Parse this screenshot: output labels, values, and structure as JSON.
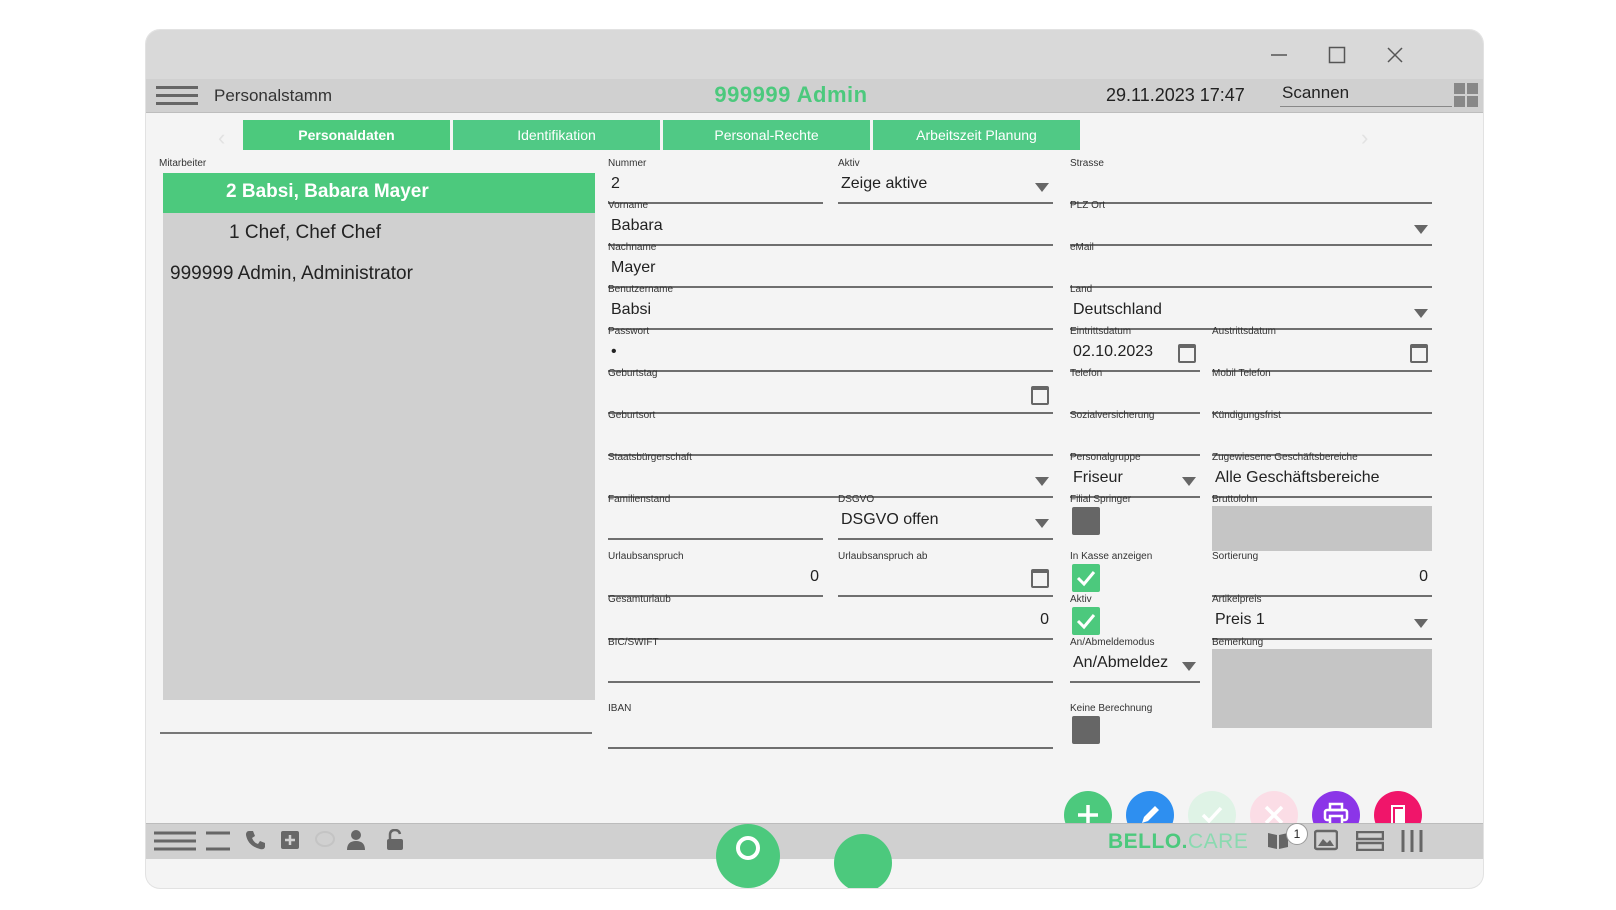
{
  "window": {
    "controls": {
      "minimize": "minimize-icon",
      "maximize": "maximize-icon",
      "close": "close-icon"
    }
  },
  "header": {
    "title": "Personalstamm",
    "user": "999999 Admin",
    "datetime": "29.11.2023 17:47",
    "scan_placeholder": "Scannen"
  },
  "tabs": [
    "Personaldaten",
    "Identifikation",
    "Personal-Rechte",
    "Arbeitszeit Planung"
  ],
  "employees": {
    "label": "Mitarbeiter",
    "items": [
      "2 Babsi, Babara Mayer",
      "1 Chef, Chef Chef",
      "999999 Admin, Administrator"
    ],
    "selected_index": 0
  },
  "form": {
    "nummer": {
      "label": "Nummer",
      "value": "2"
    },
    "aktiv_filter": {
      "label": "Aktiv",
      "value": "Zeige aktive"
    },
    "strasse": {
      "label": "Strasse",
      "value": ""
    },
    "vorname": {
      "label": "Vorname",
      "value": "Babara"
    },
    "plz_ort": {
      "label": "PLZ Ort",
      "value": ""
    },
    "nachname": {
      "label": "Nachname",
      "value": "Mayer"
    },
    "email": {
      "label": "eMail",
      "value": ""
    },
    "benutzername": {
      "label": "Benutzername",
      "value": "Babsi"
    },
    "land": {
      "label": "Land",
      "value": "Deutschland"
    },
    "passwort": {
      "label": "Passwort",
      "value": "•"
    },
    "eintrittsdatum": {
      "label": "Eintrittsdatum",
      "value": "02.10.2023"
    },
    "austrittsdatum": {
      "label": "Austrittsdatum",
      "value": ""
    },
    "geburtstag": {
      "label": "Geburtstag",
      "value": ""
    },
    "telefon": {
      "label": "Telefon",
      "value": ""
    },
    "mobil": {
      "label": "Mobil Telefon",
      "value": ""
    },
    "geburtsort": {
      "label": "Geburtsort",
      "value": ""
    },
    "sozialversicherung": {
      "label": "Sozialversicherung",
      "value": ""
    },
    "kuendigungsfrist": {
      "label": "Kündigungsfrist",
      "value": ""
    },
    "staatsbuergerschaft": {
      "label": "Staatsbürgerschaft",
      "value": ""
    },
    "personalgruppe": {
      "label": "Personalgruppe",
      "value": "Friseur"
    },
    "geschaeftsbereiche": {
      "label": "Zugewiesene Geschäftsbereiche",
      "value": "Alle Geschäftsbereiche"
    },
    "familienstand": {
      "label": "Familienstand",
      "value": ""
    },
    "dsgvo": {
      "label": "DSGVO",
      "value": "DSGVO offen"
    },
    "filial_springer": {
      "label": "Filial Springer",
      "checked": false
    },
    "bruttolohn": {
      "label": "Bruttolohn",
      "value": ""
    },
    "urlaubsanspruch": {
      "label": "Urlaubsanspruch",
      "value": "0"
    },
    "urlaubsanspruch_ab": {
      "label": "Urlaubsanspruch ab",
      "value": ""
    },
    "in_kasse": {
      "label": "In Kasse anzeigen",
      "checked": true
    },
    "sortierung": {
      "label": "Sortierung",
      "value": "0"
    },
    "gesamturlaub": {
      "label": "Gesamturlaub",
      "value": "0"
    },
    "aktiv": {
      "label": "Aktiv",
      "checked": true
    },
    "artikelpreis": {
      "label": "Artikelpreis",
      "value": "Preis 1"
    },
    "bic": {
      "label": "BIC/SWIFT",
      "value": ""
    },
    "abmeldemodus": {
      "label": "An/Abmeldemodus",
      "value": "An/Abmeldez"
    },
    "bemerkung": {
      "label": "Bemerkung",
      "value": ""
    },
    "iban": {
      "label": "IBAN",
      "value": ""
    },
    "keine_berechnung": {
      "label": "Keine Berechnung",
      "checked": false
    }
  },
  "actions": {
    "add": {
      "icon": "plus-icon",
      "color": "#4cc97d"
    },
    "edit": {
      "icon": "pencil-icon",
      "color": "#2e8ff0"
    },
    "save": {
      "icon": "check-icon",
      "color": "#dff3e6"
    },
    "cancel": {
      "icon": "x-icon",
      "color": "#fbdde6"
    },
    "print": {
      "icon": "printer-icon",
      "color": "#8b35e8"
    },
    "exit": {
      "icon": "door-icon",
      "color": "#f0156a"
    }
  },
  "footer": {
    "brand_main": "BELLO.",
    "brand_accent": "CARE",
    "notification_count": "1"
  },
  "colors": {
    "accent": "#4cc97d",
    "panel": "#d0d0d0"
  }
}
